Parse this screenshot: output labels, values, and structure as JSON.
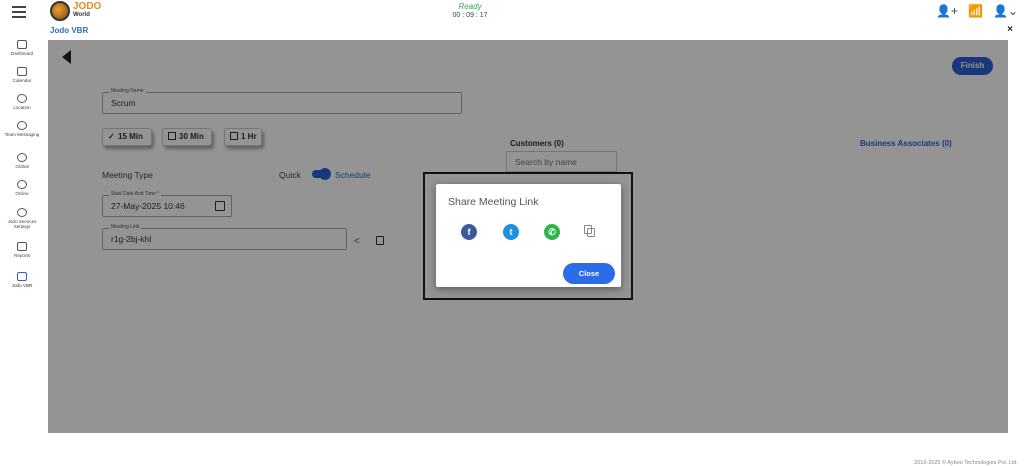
{
  "topbar": {
    "logo_line1": "JODO",
    "logo_line2": "World",
    "status": "Ready",
    "timer": "00 : 09 : 17"
  },
  "sidebar": {
    "items": [
      {
        "label": "Dashboard"
      },
      {
        "label": "Calendar"
      },
      {
        "label": "Location"
      },
      {
        "label": "Team Messaging"
      },
      {
        "label": "Global"
      },
      {
        "label": "Online"
      },
      {
        "label": "Jodo Services Settings"
      },
      {
        "label": "Reports"
      },
      {
        "label": "Jodo VBR"
      }
    ]
  },
  "panel": {
    "title": "Jodo VBR",
    "close": "×"
  },
  "form": {
    "finish_label": "Finish",
    "meeting_name_label": "Meeting Name",
    "meeting_name_value": "Scrum",
    "durations": [
      {
        "label": "15 Min",
        "checked": true
      },
      {
        "label": "30 Min",
        "checked": false
      },
      {
        "label": "1 Hr",
        "checked": false
      }
    ],
    "meeting_type_label": "Meeting Type",
    "quick_label": "Quick",
    "schedule_label": "Schedule",
    "start_date_label": "Start Date And Time *",
    "start_date_value": "27-May-2025 10:46",
    "meeting_link_label": "Meeting Link",
    "meeting_link_value": "r1g-2bj-khl",
    "customers_label": "Customers (0)",
    "search_placeholder": "Search by name",
    "business_associates_label": "Business Associates (0)"
  },
  "modal": {
    "title": "Share Meeting Link",
    "close_label": "Close",
    "icons": [
      "facebook-icon",
      "twitter-icon",
      "whatsapp-icon",
      "copy-icon"
    ]
  },
  "footer": {
    "copyright": "2016-2025 © Ayboo Technologies Pvt. Ltd."
  }
}
